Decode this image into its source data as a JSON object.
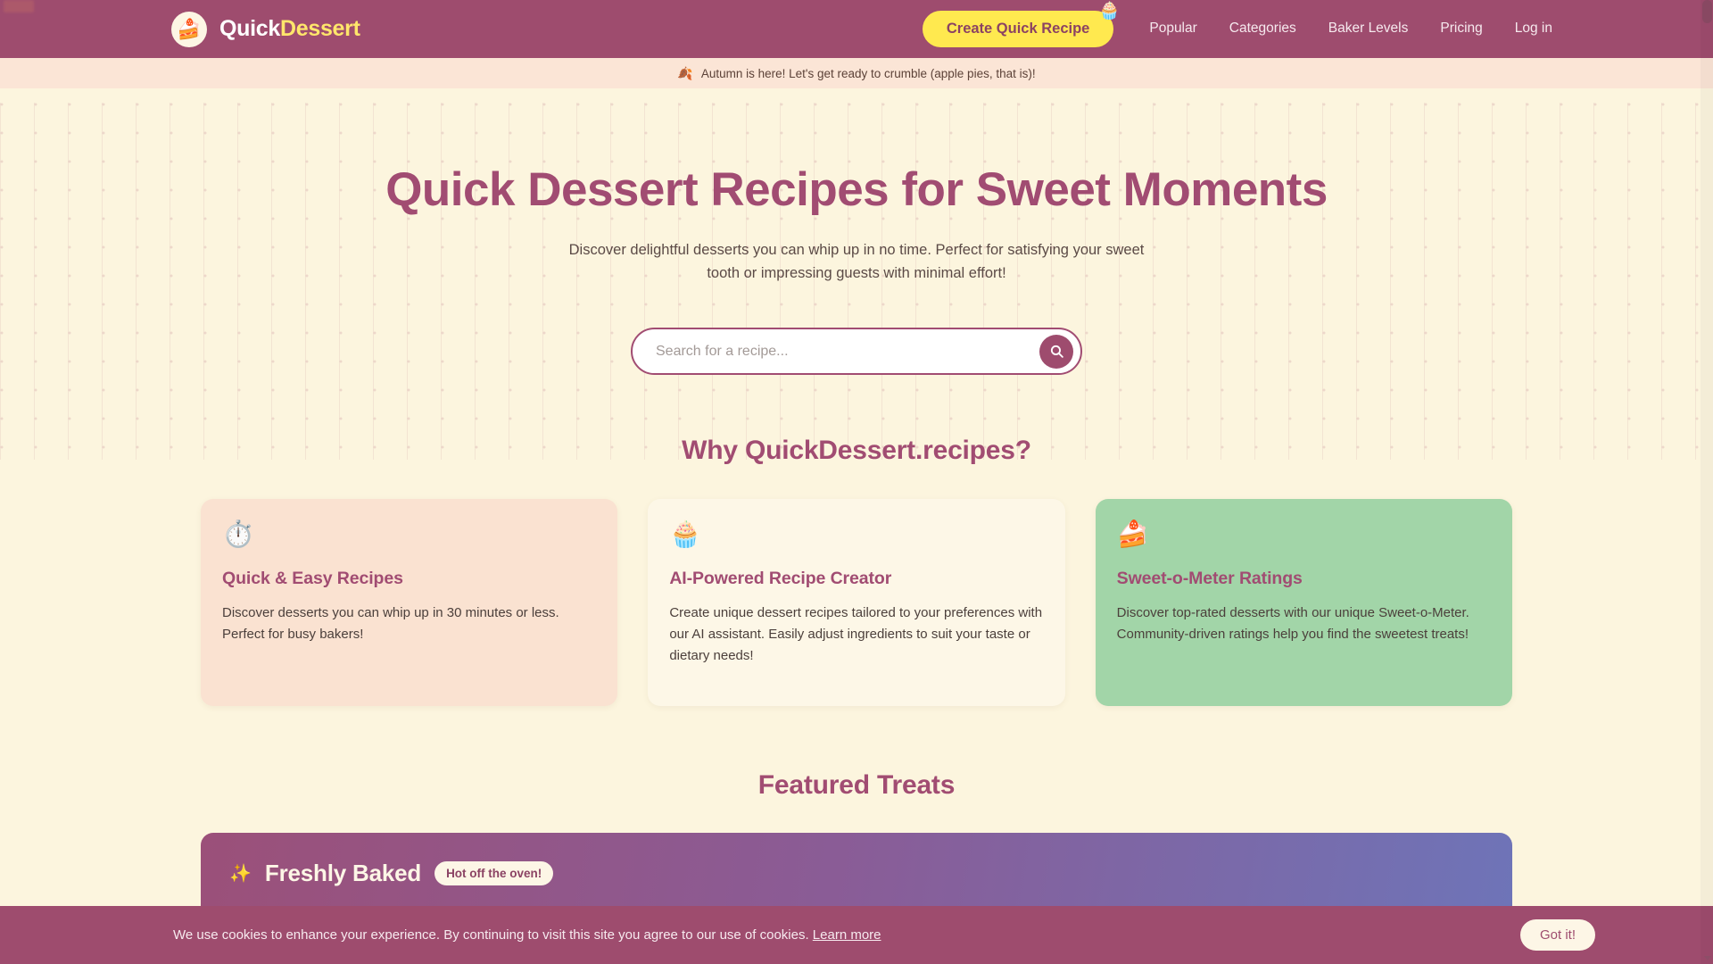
{
  "brand": {
    "icon": "cake-slice-emoji",
    "icon_glyph": "🍰",
    "word_one": "Quick",
    "word_two": "Dessert",
    "color_word_one": "#FFFFFF",
    "color_word_two": "#FFE66B"
  },
  "topbar": {
    "background": "#9E4C6E",
    "cta": {
      "label": "Create Quick Recipe",
      "background": "#FFE94F",
      "text_color": "#8B4263",
      "badge_emoji": "🧁",
      "badge_icon_name": "cupcake-icon"
    },
    "links": [
      {
        "label": "Popular"
      },
      {
        "label": "Categories"
      },
      {
        "label": "Baker Levels"
      },
      {
        "label": "Pricing"
      },
      {
        "label": "Log in"
      }
    ]
  },
  "announcement": {
    "emoji": "🍂",
    "icon_name": "fallen-leaf-icon",
    "text": "Autumn is here! Let's get ready to crumble (apple pies, that is)!",
    "background": "#FBE5D6"
  },
  "hero": {
    "title": "Quick Dessert Recipes for Sweet Moments",
    "subtitle": "Discover delightful desserts you can whip up in no time. Perfect for satisfying your sweet tooth or impressing guests with minimal effort!",
    "title_color": "#A14C72"
  },
  "search": {
    "placeholder": "Search for a recipe...",
    "value": "",
    "button_icon": "search-icon",
    "button_color": "#9E4C6E"
  },
  "why": {
    "heading": "Why QuickDessert.recipes?",
    "cards": [
      {
        "emoji": "⏱️",
        "icon_name": "stopwatch-icon",
        "title": "Quick & Easy Recipes",
        "text": "Discover desserts you can whip up in 30 minutes or less. Perfect for busy bakers!",
        "background": "#FAE2D1"
      },
      {
        "emoji": "🧁",
        "icon_name": "cupcake-icon",
        "title": "AI-Powered Recipe Creator",
        "text": "Create unique dessert recipes tailored to your preferences with our AI assistant. Easily adjust ingredients to suit your taste or dietary needs!",
        "background": "#FDF7E7"
      },
      {
        "emoji": "🍰",
        "icon_name": "shortcake-icon",
        "title": "Sweet-o-Meter Ratings",
        "text": "Discover top-rated desserts with our unique Sweet-o-Meter. Community-driven ratings help you find the sweetest treats!",
        "background": "#A2D5A8"
      }
    ]
  },
  "featured": {
    "heading": "Featured Treats",
    "panel": {
      "sparkle_emoji": "✨",
      "sparkle_icon_name": "sparkles-icon",
      "label": "Freshly Baked",
      "badge": "Hot off the oven!",
      "gradient_from": "#9B5079",
      "gradient_to": "#6E74B8"
    }
  },
  "cookie": {
    "text": "We use cookies to enhance your experience. By continuing to visit this site you agree to our use of cookies.",
    "link_label": "Learn more",
    "accept_label": "Got it!",
    "background": "#9E4C6E"
  }
}
